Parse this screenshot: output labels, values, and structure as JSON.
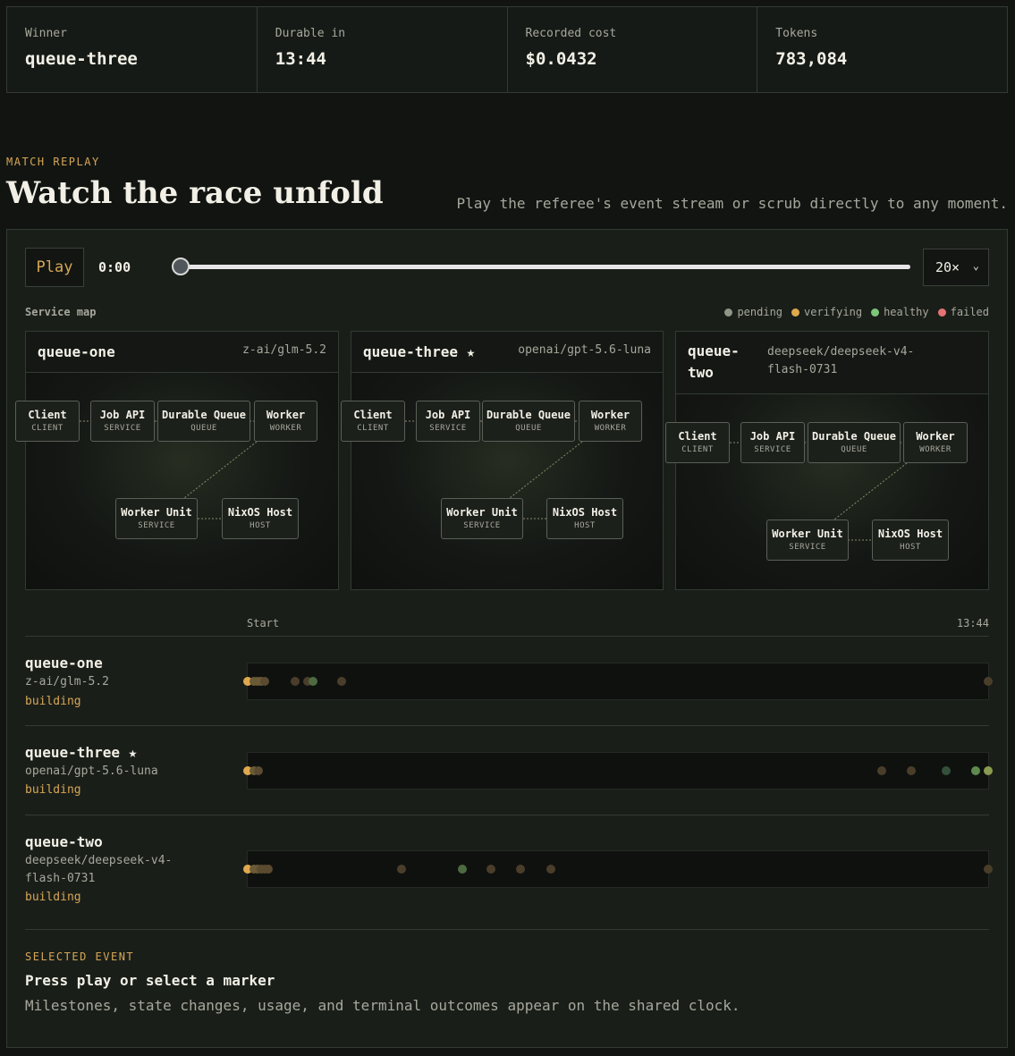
{
  "stats": [
    {
      "label": "Winner",
      "value": "queue-three"
    },
    {
      "label": "Durable in",
      "value": "13:44"
    },
    {
      "label": "Recorded cost",
      "value": "$0.0432"
    },
    {
      "label": "Tokens",
      "value": "783,084"
    }
  ],
  "header": {
    "kicker": "MATCH REPLAY",
    "title": "Watch the race unfold",
    "subtitle": "Play the referee's event stream or scrub directly to any moment."
  },
  "controls": {
    "play_label": "Play",
    "clock": "0:00",
    "scrub_progress": 0,
    "speed": "20×"
  },
  "service_map": {
    "label": "Service map",
    "legend": [
      {
        "label": "pending",
        "color": "#8e9688"
      },
      {
        "label": "verifying",
        "color": "#e0a94e"
      },
      {
        "label": "healthy",
        "color": "#7cc77a"
      },
      {
        "label": "failed",
        "color": "#e57373"
      }
    ],
    "maps": [
      {
        "name": "queue-one",
        "model": "z-ai/glm-5.2"
      },
      {
        "name": "queue-three ★",
        "model": "openai/gpt-5.6-luna"
      },
      {
        "name": "queue-two",
        "model": "deepseek/deepseek-v4-flash-0731"
      }
    ],
    "nodes": [
      {
        "name": "Client",
        "type": "CLIENT"
      },
      {
        "name": "Job API",
        "type": "SERVICE"
      },
      {
        "name": "Durable Queue",
        "type": "QUEUE"
      },
      {
        "name": "Worker",
        "type": "WORKER"
      },
      {
        "name": "Worker Unit",
        "type": "SERVICE"
      },
      {
        "name": "NixOS Host",
        "type": "HOST"
      }
    ]
  },
  "timeline": {
    "start_label": "Start",
    "end_label": "13:44",
    "lanes": [
      {
        "name": "queue-one",
        "model": "z-ai/glm-5.2",
        "status": "building"
      },
      {
        "name": "queue-three ★",
        "model": "openai/gpt-5.6-luna",
        "status": "building"
      },
      {
        "name": "queue-two",
        "model": "deepseek/deepseek-v4-flash-0731",
        "status": "building"
      }
    ]
  },
  "selected_event": {
    "kicker": "SELECTED EVENT",
    "title": "Press play or select a marker",
    "description": "Milestones, state changes, usage, and terminal outcomes appear on the shared clock."
  }
}
